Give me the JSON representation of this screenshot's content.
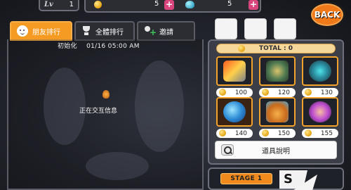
{
  "top": {
    "level_icon": "Lv",
    "level": "1",
    "coins": "5",
    "gems": "5",
    "back_label": "BACK"
  },
  "tabs": [
    {
      "label": "朋友排行",
      "icon": "friend-face-icon",
      "active": true
    },
    {
      "label": "全體排行",
      "icon": "trophy-icon",
      "active": false
    },
    {
      "label": "邀請",
      "icon": "invite-user-icon",
      "active": false
    }
  ],
  "main": {
    "reset_label": "初始化",
    "reset_time": "01/16 05:00 AM",
    "loading_text": "正在交互信息"
  },
  "shop": {
    "total_label": "TOTAL : 0",
    "items": [
      {
        "icon": "fire-sword-icon",
        "price": "100"
      },
      {
        "icon": "shield-armor-icon",
        "price": "120"
      },
      {
        "icon": "ninja-spin-icon",
        "price": "130"
      },
      {
        "icon": "blue-orb-icon",
        "price": "140"
      },
      {
        "icon": "magic-pot-icon",
        "price": "150"
      },
      {
        "icon": "power-fist-icon",
        "price": "155"
      }
    ],
    "desc_label": "道具說明"
  },
  "stage": {
    "label": "STAGE 1",
    "letter": "S"
  },
  "colors": {
    "accent": "#f59a22",
    "plus": "#d9467d"
  }
}
